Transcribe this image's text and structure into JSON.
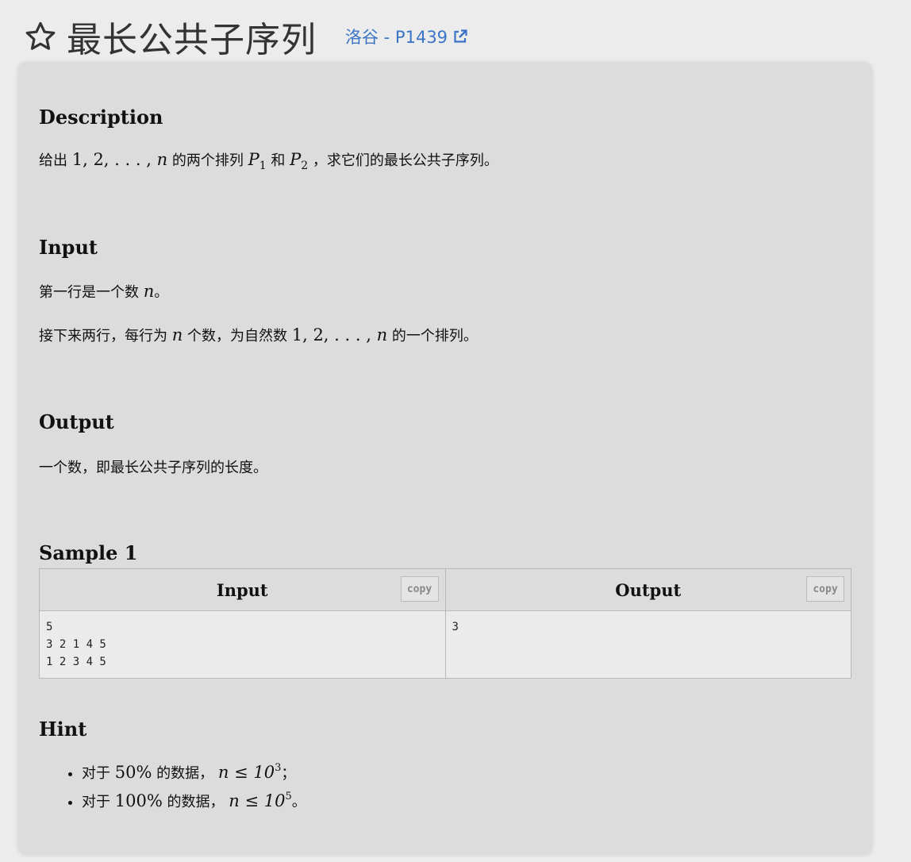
{
  "header": {
    "title": "最长公共子序列",
    "source_label": "洛谷 - P1439"
  },
  "description": {
    "heading": "Description",
    "t1": "给出",
    "seq_digits": "1, 2, . . . , ",
    "n": "n",
    "t2": "的两个排列",
    "p": "P",
    "p1_sub": "1",
    "t3": "和",
    "p2_sub": "2",
    "t4": "，求它们的最长公共子序列。"
  },
  "input": {
    "heading": "Input",
    "line1_text": "第一行是一个数",
    "line1_end": "。",
    "line2_a": "接下来两行，每行为",
    "line2_b": "个数，为自然数",
    "line2_c": "的一个排列。"
  },
  "output": {
    "heading": "Output",
    "text": "一个数，即最长公共子序列的长度。"
  },
  "sample": {
    "heading": "Sample 1",
    "input_label": "Input",
    "output_label": "Output",
    "copy_label": "copy",
    "input_text": "5\n3 2 1 4 5\n1 2 3 4 5",
    "output_text": "3"
  },
  "hint": {
    "heading": "Hint",
    "i1_a": "对于",
    "i1_pct": "50%",
    "i1_b": "的数据，",
    "i1_math": "n ≤ 10",
    "i1_exp": "3",
    "i1_end": "；",
    "i2_a": "对于",
    "i2_pct": "100%",
    "i2_b": "的数据，",
    "i2_math": "n ≤ 10",
    "i2_exp": "5",
    "i2_end": "。"
  },
  "icons": {
    "star": "star-outline-icon",
    "external": "external-link-icon"
  },
  "colors": {
    "link": "#3b74c6",
    "card": "#dcdcdc",
    "page": "#ececec"
  }
}
